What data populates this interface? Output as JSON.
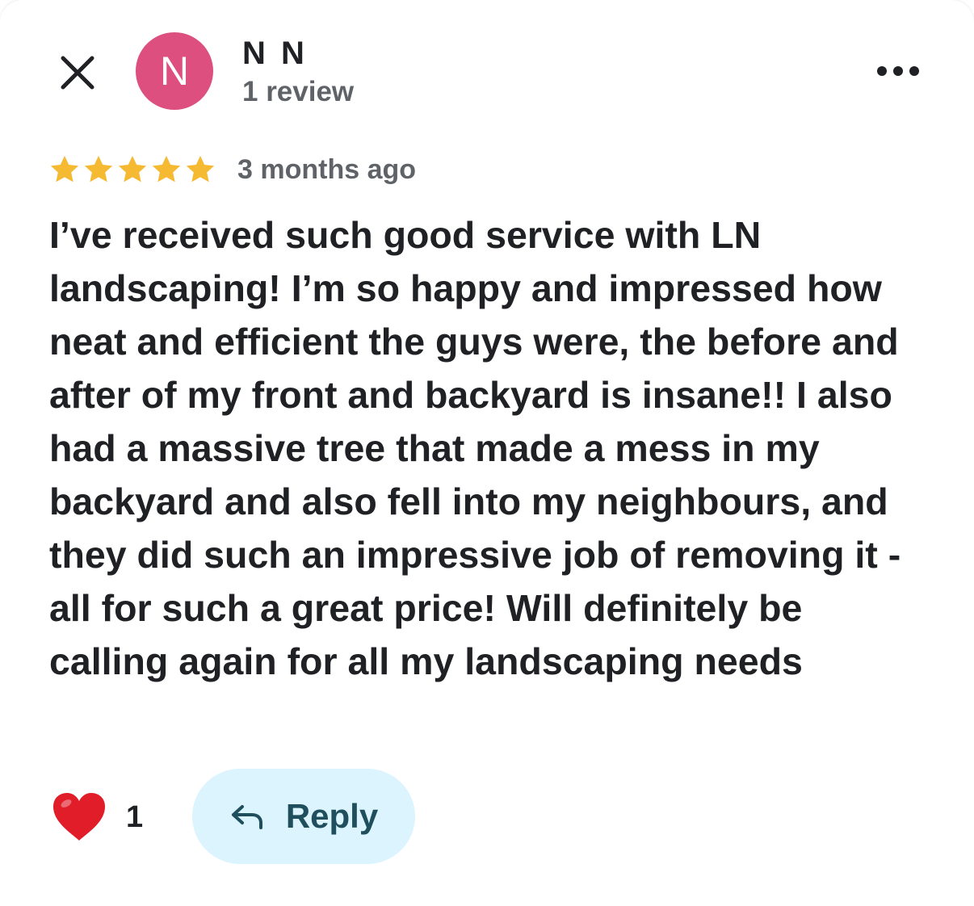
{
  "colors": {
    "avatar_bg": "#DD4F7E",
    "star": "#F5B932",
    "heart": "#E11D2A",
    "reply_bg": "#DBF4FD",
    "reply_text": "#1F4E5C",
    "secondary_text": "#5F6368",
    "primary_text": "#202124"
  },
  "header": {
    "close_icon": "close-icon",
    "more_icon": "more-horizontal-icon"
  },
  "author": {
    "avatar_letter": "N",
    "name": "N N",
    "meta": "1 review"
  },
  "review": {
    "rating": 5,
    "max_rating": 5,
    "date": "3 months ago",
    "text": "I’ve received such good service with LN landscaping! I’m so happy and impressed how neat and efficient the guys were, the before and after of my front and backyard is insane!! I also had a massive tree that made a mess in my backyard and also fell into my neighbours, and they did such an impressive job of removing it - all for such a great price! Will definitely be calling again for all my landscaping needs"
  },
  "actions": {
    "like_icon": "heart-icon",
    "like_count": "1",
    "reply_icon": "reply-arrow-icon",
    "reply_label": "Reply"
  }
}
